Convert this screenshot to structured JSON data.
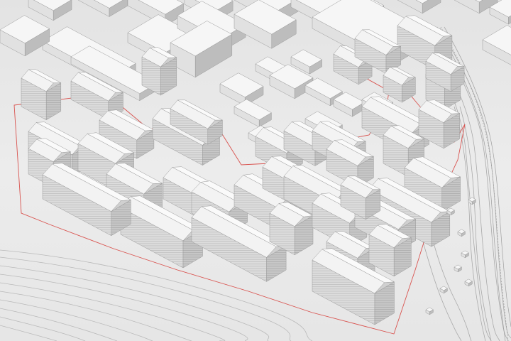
{
  "image": {
    "kind": "architectural-massing-model",
    "palette": {
      "ground": "#e9e9e9",
      "ground_light": "#efefef",
      "roof": "#f6f6f6",
      "wall_light": "#e1e1e1",
      "wall_dark": "#bdbdbd",
      "outline": "#9a9a9a",
      "contour": "#b8b8b8",
      "site_boundary": "#d9534f"
    }
  }
}
